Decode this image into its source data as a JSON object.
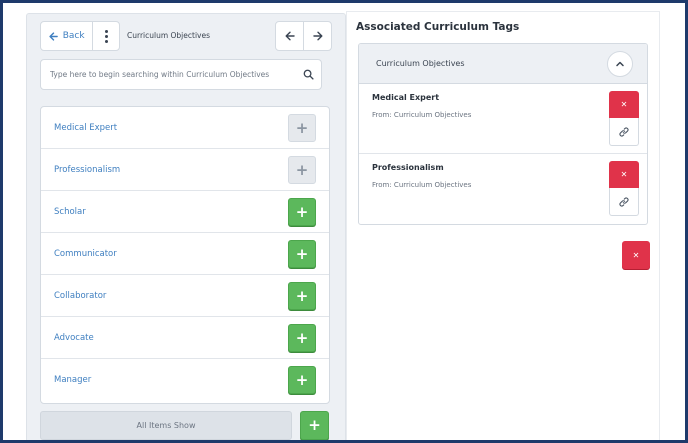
{
  "toolbar": {
    "back_label": "Back",
    "title": "Curriculum Objectives"
  },
  "search": {
    "placeholder": "Type here to begin searching within Curriculum Objectives"
  },
  "list": {
    "items": [
      {
        "label": "Medical Expert",
        "state": "added"
      },
      {
        "label": "Professionalism",
        "state": "added"
      },
      {
        "label": "Scholar",
        "state": "available"
      },
      {
        "label": "Communicator",
        "state": "available"
      },
      {
        "label": "Collaborator",
        "state": "available"
      },
      {
        "label": "Advocate",
        "state": "available"
      },
      {
        "label": "Manager",
        "state": "available"
      }
    ],
    "footer_label": "All Items Show"
  },
  "associated": {
    "title": "Associated Curriculum Tags",
    "group_label": "Curriculum Objectives",
    "tags": [
      {
        "name": "Medical Expert",
        "source": "From: Curriculum Objectives"
      },
      {
        "name": "Professionalism",
        "source": "From: Curriculum Objectives"
      }
    ]
  },
  "colors": {
    "link_blue": "#3f7fc0",
    "add_green": "#5cb85c",
    "remove_red": "#e0334a",
    "panel_gray": "#edf0f4",
    "frame_navy": "#1e3a6b"
  },
  "icons": {
    "back": "arrow-left-icon",
    "menu": "kebab-menu-icon",
    "prev": "arrow-left-icon",
    "next": "arrow-right-icon",
    "search": "search-icon",
    "add": "plus-icon",
    "remove": "close-icon",
    "link": "link-icon",
    "collapse": "chevron-up-icon"
  }
}
